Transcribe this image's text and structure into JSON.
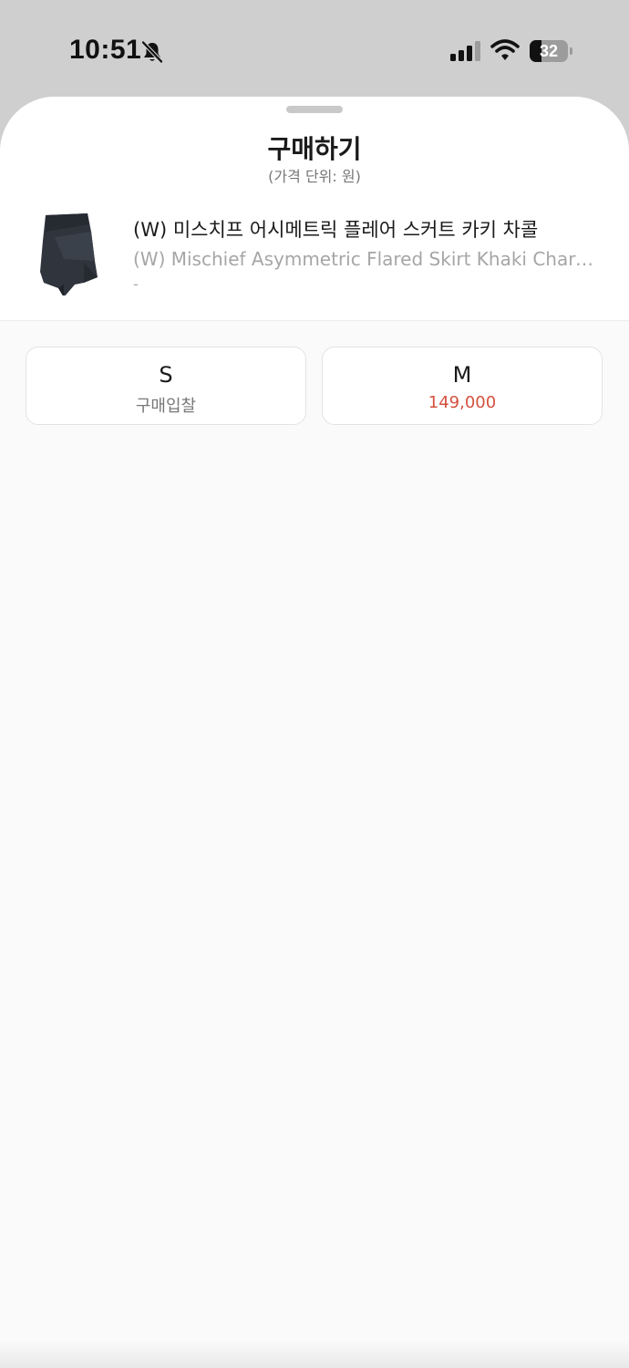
{
  "status_bar": {
    "time": "10:51",
    "battery": "32",
    "battery_level": 0.32
  },
  "sheet": {
    "title": "구매하기",
    "subtitle": "(가격 단위: 원)"
  },
  "product": {
    "name_ko": "(W) 미스치프 어시메트릭 플레어 스커트 카키 차콜",
    "name_en": "(W) Mischief Asymmetric Flared Skirt Khaki Charcoal",
    "extra": "-"
  },
  "sizes": [
    {
      "label": "S",
      "price": "구매입찰"
    },
    {
      "label": "M",
      "price": "149,000"
    }
  ],
  "colors": {
    "accent": "#d4513f"
  }
}
